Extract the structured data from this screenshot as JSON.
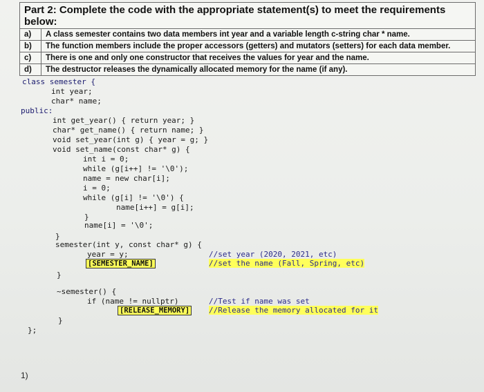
{
  "requirements": {
    "title": "Part 2: Complete the code with the appropriate statement(s) to meet the requirements below:",
    "items": [
      {
        "letter": "a)",
        "text": "A class semester contains two data members int year and a variable length c-string char * name."
      },
      {
        "letter": "b)",
        "text": "The function members include the proper accessors (getters) and mutators (setters) for each data member."
      },
      {
        "letter": "c)",
        "text": "There is one and only one constructor that receives the values for year and the name."
      },
      {
        "letter": "d)",
        "text": "The destructor releases the dynamically allocated memory for the name (if any)."
      }
    ]
  },
  "code": {
    "l01": "class semester {",
    "l02": "int year;",
    "l03": "char* name;",
    "l04": "public:",
    "l05": "int get_year() { return year; }",
    "l06": "char* get_name() { return name; }",
    "l07": "void set_year(int g) { year = g; }",
    "l08": "void set_name(const char* g) {",
    "l09": "int i = 0;",
    "l10": "while (g[i++] != '\\0');",
    "l11": "name = new char[i];",
    "l12": "i = 0;",
    "l13": "while (g[i] != '\\0') {",
    "l14": "name[i++] = g[i];",
    "l15": "}",
    "l16": "name[i] = '\\0';",
    "l17": "}",
    "l18": "semester(int y, const char* g) {",
    "l19": "year = y;",
    "l20": "}",
    "l21": "~semester() {",
    "l22": "if (name != nullptr)",
    "l23": "}",
    "l24": "};"
  },
  "placeholders": {
    "semester_name": "[SEMESTER_NAME]",
    "release_memory": "[RELEASE_MEMORY]"
  },
  "comments": {
    "set_year": "//set year (2020, 2021, etc)",
    "set_name": "//set the name (Fall, Spring, etc)",
    "test_name": "//Test if name was set",
    "release": "//Release the memory allocated for it"
  },
  "footer": {
    "number": "1)"
  },
  "colors": {
    "highlight": "#ffff5a",
    "comment": "#2b2b8a"
  }
}
